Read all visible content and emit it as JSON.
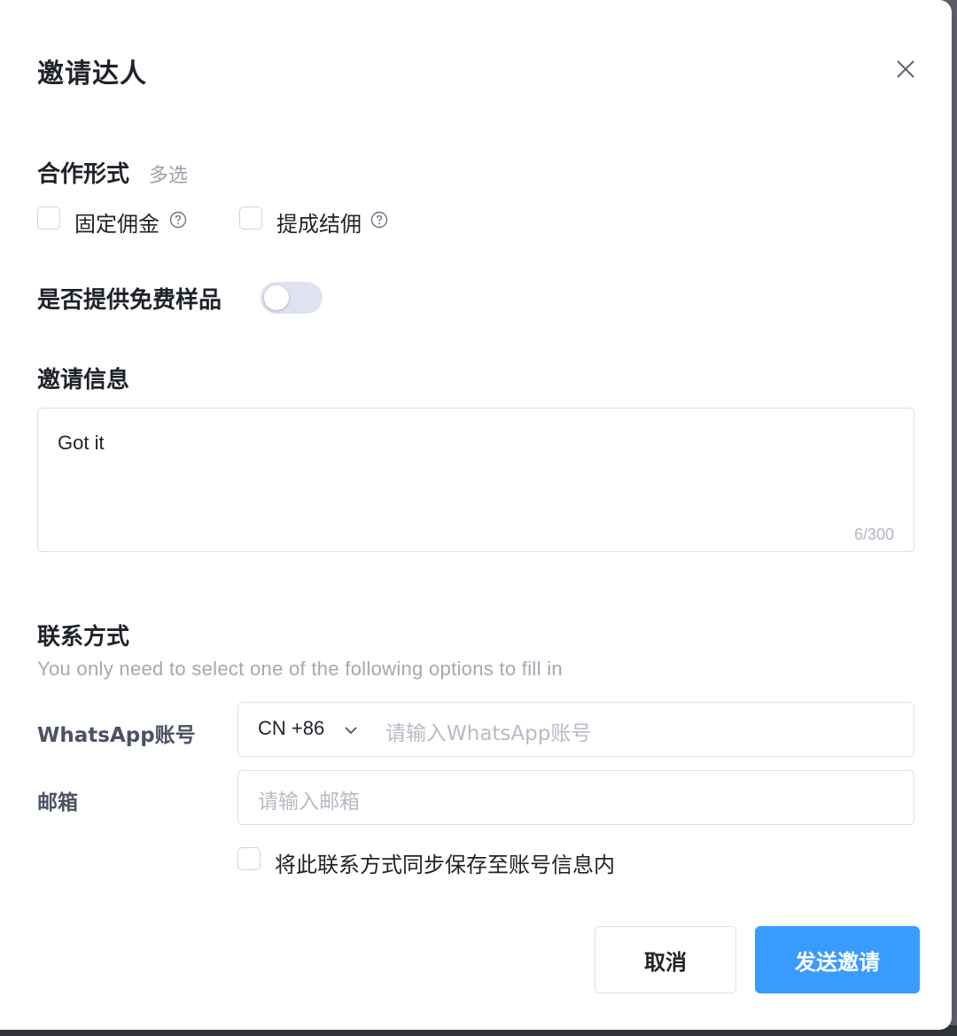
{
  "dialog": {
    "title": "邀请达人"
  },
  "cooperation": {
    "label": "合作形式",
    "hint": "多选",
    "options": [
      {
        "label": "固定佣金",
        "checked": false
      },
      {
        "label": "提成结佣",
        "checked": false
      }
    ]
  },
  "free_sample": {
    "label": "是否提供免费样品",
    "enabled": false
  },
  "invite_message": {
    "label": "邀请信息",
    "value": "Got it",
    "counter": "6/300"
  },
  "contact": {
    "label": "联系方式",
    "subtitle": "You only need to select one of the following options to fill in",
    "whatsapp": {
      "label": "WhatsApp账号",
      "country_code": "CN +86",
      "placeholder": "请输入WhatsApp账号"
    },
    "email": {
      "label": "邮箱",
      "placeholder": "请输入邮箱"
    },
    "sync": {
      "label": "将此联系方式同步保存至账号信息内",
      "checked": false
    }
  },
  "actions": {
    "cancel_label": "取消",
    "send_label": "发送邀请"
  },
  "colors": {
    "primary": "#3a9bff",
    "toggle_off": "#dfe3f0"
  }
}
